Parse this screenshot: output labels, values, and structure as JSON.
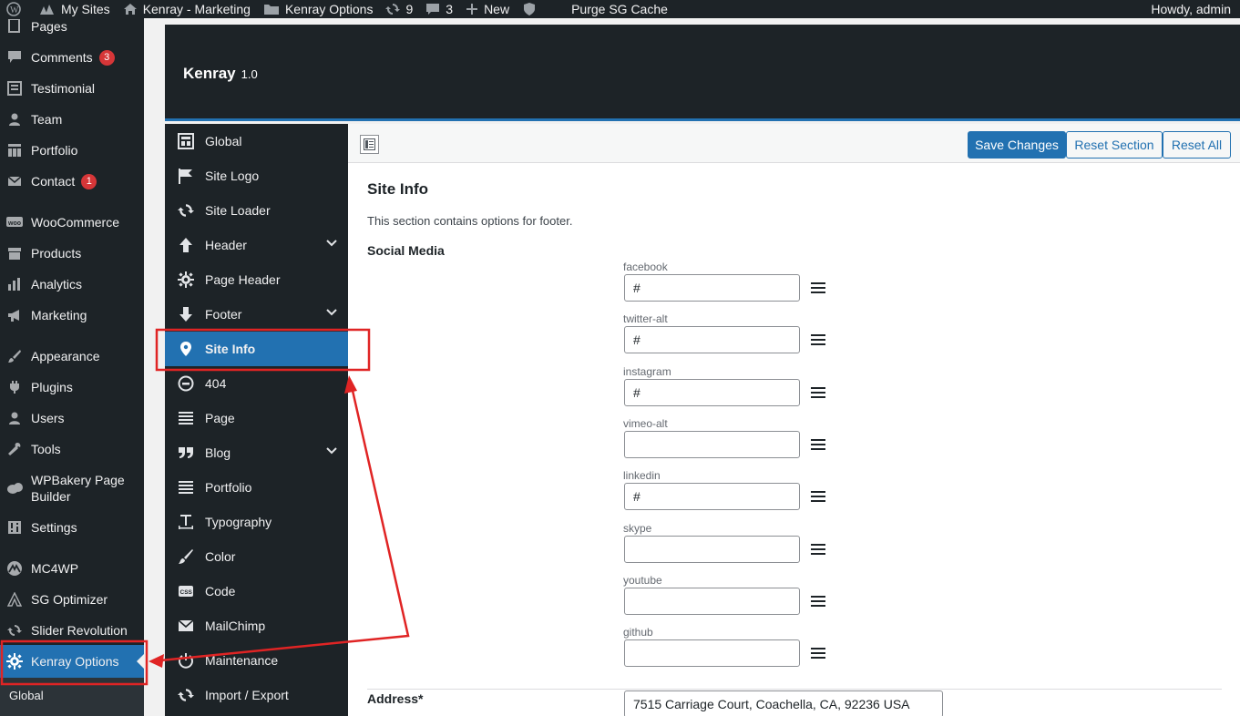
{
  "admin_bar": {
    "my_sites": "My Sites",
    "site_name": "Kenray - Marketing",
    "options": "Kenray Options",
    "updates_count": "9",
    "comments_count": "3",
    "new_label": "New",
    "purge": "Purge SG Cache",
    "howdy": "Howdy, admin"
  },
  "wp_menu": {
    "items": [
      {
        "label": "Pages",
        "icon": "pages-icon"
      },
      {
        "label": "Comments",
        "icon": "comments-icon",
        "badge": "3"
      },
      {
        "label": "Testimonial",
        "icon": "testimonial-icon"
      },
      {
        "label": "Team",
        "icon": "team-icon"
      },
      {
        "label": "Portfolio",
        "icon": "portfolio-icon"
      },
      {
        "label": "Contact",
        "icon": "mail-icon",
        "badge": "1"
      },
      {
        "label": "WooCommerce",
        "icon": "woocommerce-icon"
      },
      {
        "label": "Products",
        "icon": "products-icon"
      },
      {
        "label": "Analytics",
        "icon": "analytics-icon"
      },
      {
        "label": "Marketing",
        "icon": "megaphone-icon"
      },
      {
        "label": "Appearance",
        "icon": "paintbrush-icon"
      },
      {
        "label": "Plugins",
        "icon": "plugin-icon"
      },
      {
        "label": "Users",
        "icon": "users-icon"
      },
      {
        "label": "Tools",
        "icon": "wrench-icon"
      },
      {
        "label": "WPBakery Page",
        "label2": "Builder",
        "icon": "wpbakery-icon"
      },
      {
        "label": "Settings",
        "icon": "settings-icon"
      },
      {
        "label": "MC4WP",
        "icon": "mc4wp-icon"
      },
      {
        "label": "SG Optimizer",
        "icon": "sg-optimizer-icon"
      },
      {
        "label": "Slider Revolution",
        "icon": "refresh-icon"
      },
      {
        "label": "Kenray Options",
        "icon": "gear-icon"
      }
    ],
    "submenu": "Global"
  },
  "options_panel": {
    "title": "Kenray",
    "version": "1.0",
    "nav": [
      {
        "label": "Global",
        "icon": "layout-icon"
      },
      {
        "label": "Site Logo",
        "icon": "flag-icon"
      },
      {
        "label": "Site Loader",
        "icon": "refresh-icon"
      },
      {
        "label": "Header",
        "icon": "arrow-up-icon",
        "submenu": true
      },
      {
        "label": "Page Header",
        "icon": "gear-icon"
      },
      {
        "label": "Footer",
        "icon": "arrow-down-icon",
        "submenu": true
      },
      {
        "label": "Site Info",
        "icon": "location-pin-icon"
      },
      {
        "label": "404",
        "icon": "minus-circle-icon"
      },
      {
        "label": "Page",
        "icon": "lines-icon"
      },
      {
        "label": "Blog",
        "icon": "quote-icon",
        "submenu": true
      },
      {
        "label": "Portfolio",
        "icon": "lines-icon"
      },
      {
        "label": "Typography",
        "icon": "text-cursor-icon"
      },
      {
        "label": "Color",
        "icon": "brush-icon"
      },
      {
        "label": "Code",
        "icon": "css-icon"
      },
      {
        "label": "MailChimp",
        "icon": "envelope-icon"
      },
      {
        "label": "Maintenance",
        "icon": "power-icon"
      },
      {
        "label": "Import / Export",
        "icon": "refresh-icon"
      }
    ],
    "buttons": {
      "save": "Save Changes",
      "reset_section": "Reset Section",
      "reset_all": "Reset All"
    },
    "section": {
      "title": "Site Info",
      "description": "This section contains options for footer.",
      "social_label": "Social Media",
      "social": [
        {
          "name": "facebook",
          "value": "#"
        },
        {
          "name": "twitter-alt",
          "value": "#"
        },
        {
          "name": "instagram",
          "value": "#"
        },
        {
          "name": "vimeo-alt",
          "value": ""
        },
        {
          "name": "linkedin",
          "value": "#"
        },
        {
          "name": "skype",
          "value": ""
        },
        {
          "name": "youtube",
          "value": ""
        },
        {
          "name": "github",
          "value": ""
        }
      ],
      "address_label": "Address*",
      "address_value": "7515 Carriage Court, Coachella, CA, 92236 USA"
    }
  },
  "colors": {
    "admin_dark": "#1d2327",
    "accent_blue": "#2271b1",
    "annotation_red": "#e02424"
  }
}
